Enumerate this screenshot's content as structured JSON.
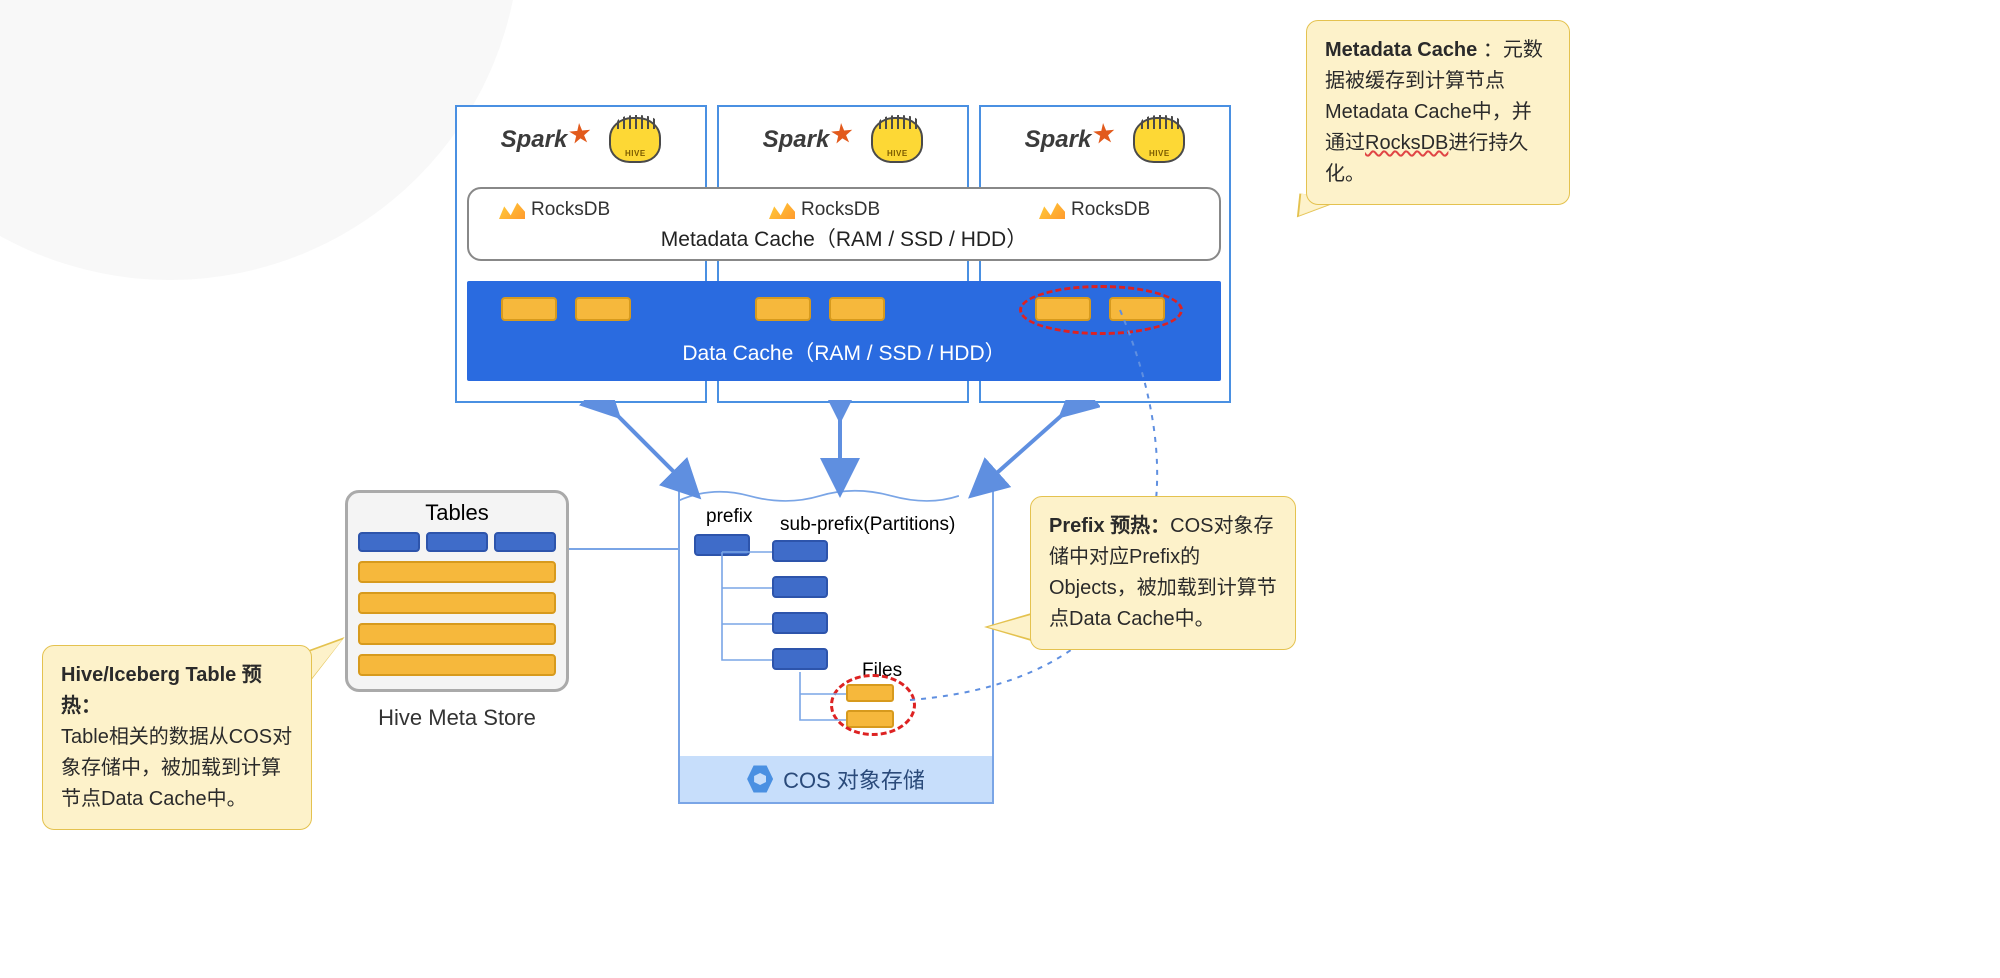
{
  "logos": {
    "spark": "Spark",
    "hive_badge": "HIVE",
    "rocksdb": "RocksDB"
  },
  "metadata_cache_label": "Metadata Cache（RAM / SSD / HDD）",
  "data_cache_label": "Data Cache（RAM / SSD / HDD）",
  "hive_meta_store": {
    "title": "Tables",
    "caption": "Hive Meta Store"
  },
  "cos": {
    "prefix": "prefix",
    "sub_prefix": "sub-prefix(Partitions)",
    "files": "Files",
    "footer": "COS 对象存储"
  },
  "callouts": {
    "top": {
      "bold": "Metadata Cache",
      "sep": " ：",
      "text1": "元数据被缓存到计算节点Metadata Cache中，并通过",
      "rocks": "RocksDB",
      "text2": "进行持久化。"
    },
    "mid": {
      "bold": "Prefix 预热：",
      "text": "COS对象存储中对应Prefix的Objects，被加载到计算节点Data Cache中。"
    },
    "left": {
      "bold": "Hive/Iceberg Table 预热：",
      "text": "Table相关的数据从COS对象存储中，被加载到计算节点Data Cache中。"
    }
  }
}
